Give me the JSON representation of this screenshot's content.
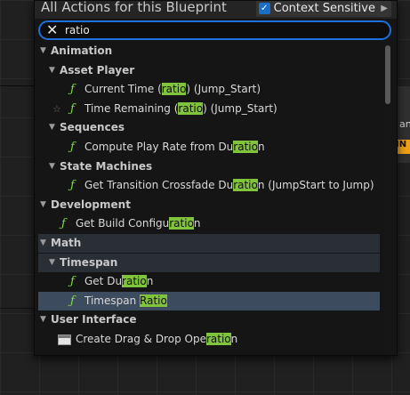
{
  "background": {
    "node_text": "an",
    "node_tag": "IN"
  },
  "header": {
    "title": "All Actions for this Blueprint",
    "context_sensitive_label": "Context Sensitive",
    "context_sensitive_checked": true
  },
  "search": {
    "value": "ratio",
    "placeholder": ""
  },
  "rows": [
    {
      "kind": "cat",
      "level": 0,
      "label": "Animation"
    },
    {
      "kind": "cat",
      "level": 1,
      "label": "Asset Player"
    },
    {
      "kind": "fn",
      "level": 2,
      "pre": "Current Time (",
      "match": "ratio",
      "post": ") (Jump_Start)"
    },
    {
      "kind": "fn",
      "level": 2,
      "star": true,
      "pre": "Time Remaining (",
      "match": "ratio",
      "post": ") (Jump_Start)"
    },
    {
      "kind": "cat",
      "level": 1,
      "label": "Sequences"
    },
    {
      "kind": "fn",
      "level": 2,
      "pre": "Compute Play Rate from Du",
      "match": "ratio",
      "post": "n"
    },
    {
      "kind": "cat",
      "level": 1,
      "label": "State Machines"
    },
    {
      "kind": "fn",
      "level": 2,
      "pre": "Get Transition Crossfade Du",
      "match": "ratio",
      "post": "n (JumpStart to Jump)"
    },
    {
      "kind": "cat",
      "level": 0,
      "label": "Development"
    },
    {
      "kind": "fn",
      "level": 1,
      "pre": "Get Build Configu",
      "match": "ratio",
      "post": "n"
    },
    {
      "kind": "cat",
      "level": 0,
      "label": "Math",
      "highlight": true
    },
    {
      "kind": "cat",
      "level": 1,
      "label": "Timespan",
      "highlight": true
    },
    {
      "kind": "fn",
      "level": 2,
      "pre": "Get Du",
      "match": "ratio",
      "post": "n"
    },
    {
      "kind": "fn",
      "level": 2,
      "selected": true,
      "pre": "Timespan ",
      "match": "Ratio",
      "post": ""
    },
    {
      "kind": "cat",
      "level": 0,
      "label": "User Interface"
    },
    {
      "kind": "dd",
      "level": 1,
      "pre": "Create Drag & Drop Ope",
      "match": "ratio",
      "post": "n"
    }
  ],
  "icons": {
    "function": "ƒ",
    "star": "☆",
    "clear": "✕"
  },
  "colors": {
    "accent": "#1e6fd9",
    "match_highlight": "#7fc43a",
    "selection": "#3d4b5e",
    "function_icon": "#7fdc3f"
  }
}
